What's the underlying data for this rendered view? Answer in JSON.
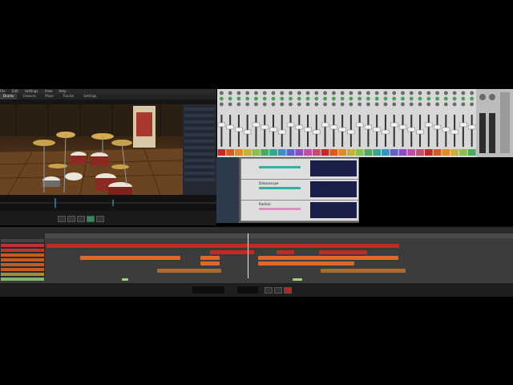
{
  "drum_app": {
    "menu": [
      "File",
      "Edit",
      "Settings",
      "View",
      "Help"
    ],
    "tabs": [
      "Drums",
      "Grooves",
      "Mixer",
      "Tracker",
      "Settings"
    ],
    "active_tab": "Drums"
  },
  "mixer": {
    "channel_count": 30,
    "colors": [
      "#c42a2a",
      "#d95b1f",
      "#e08b24",
      "#c9b03a",
      "#8cc04c",
      "#4ca85a",
      "#36a58f",
      "#3a8fc6",
      "#5a63c8",
      "#8f4cc0",
      "#c04ca6",
      "#c44c6c"
    ]
  },
  "rack": {
    "devices": [
      {
        "title": ""
      },
      {
        "title": "Dakuoscope"
      },
      {
        "title": "Radical"
      }
    ],
    "accent_teal": "#31b3a3",
    "accent_pink": "#e08fc2"
  },
  "sequencer": {
    "clip_colors": {
      "red": "#c22a2a",
      "orange": "#dd6a28",
      "brown": "#b06a30",
      "green": "#9fd486"
    }
  }
}
